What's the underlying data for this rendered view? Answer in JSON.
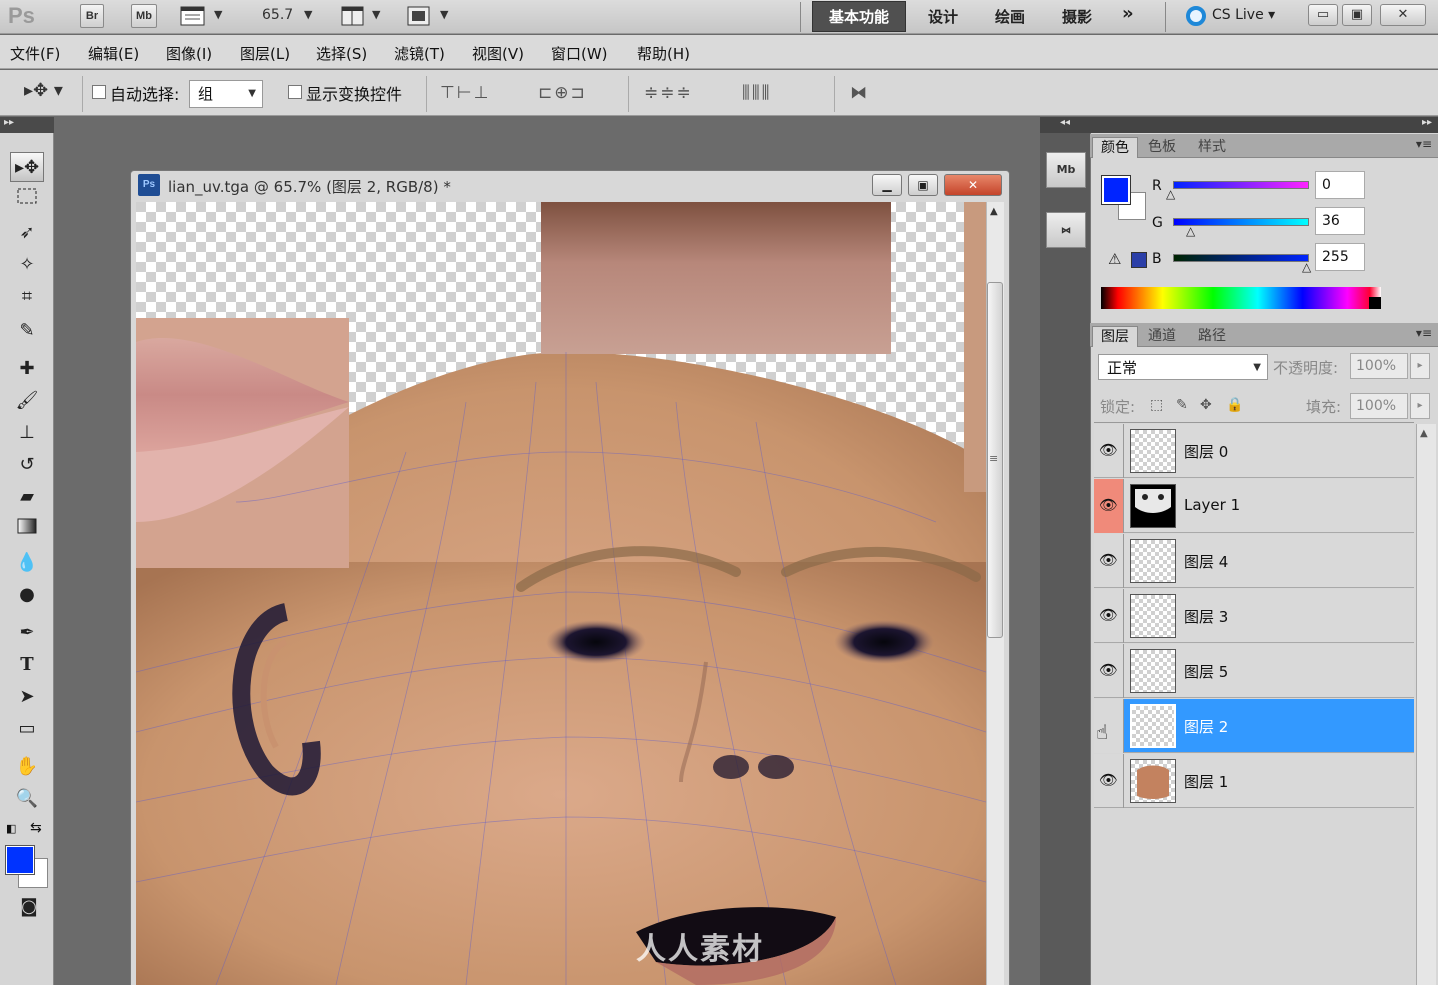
{
  "appbar": {
    "logo": "Ps",
    "bridge": "Br",
    "minibridge": "Mb",
    "zoom": "65.7",
    "workspaces": [
      "基本功能",
      "设计",
      "绘画",
      "摄影"
    ],
    "more": "»",
    "cslive": "CS Live"
  },
  "menu": [
    "文件(F)",
    "编辑(E)",
    "图像(I)",
    "图层(L)",
    "选择(S)",
    "滤镜(T)",
    "视图(V)",
    "窗口(W)",
    "帮助(H)"
  ],
  "options": {
    "auto_select_label": "自动选择:",
    "auto_select_value": "组",
    "show_transform_label": "显示变换控件"
  },
  "document": {
    "title": "lian_uv.tga @ 65.7% (图层 2, RGB/8) *",
    "icon": "Ps"
  },
  "watermark": "人人素材",
  "color_panel": {
    "tabs": [
      "颜色",
      "色板",
      "样式"
    ],
    "R": "0",
    "G": "36",
    "B": "255",
    "fg_color": "#0024ff",
    "r_label": "R",
    "g_label": "G",
    "b_label": "B"
  },
  "layers_panel": {
    "tabs": [
      "图层",
      "通道",
      "路径"
    ],
    "blend_mode": "正常",
    "opacity_label": "不透明度:",
    "opacity": "100%",
    "lock_label": "锁定:",
    "fill_label": "填充:",
    "fill": "100%",
    "layers": [
      {
        "name": "图层 0",
        "visible": true,
        "selected": false
      },
      {
        "name": "Layer 1",
        "visible": true,
        "selected": false
      },
      {
        "name": "图层 4",
        "visible": true,
        "selected": false
      },
      {
        "name": "图层 3",
        "visible": true,
        "selected": false
      },
      {
        "name": "图层 5",
        "visible": true,
        "selected": false
      },
      {
        "name": "图层 2",
        "visible": false,
        "selected": true
      },
      {
        "name": "图层 1",
        "visible": true,
        "selected": false
      }
    ]
  },
  "dock": {
    "minibridge": "Mb"
  },
  "colors": {
    "accent": "#3399ff",
    "foreground": "#0033ff"
  }
}
